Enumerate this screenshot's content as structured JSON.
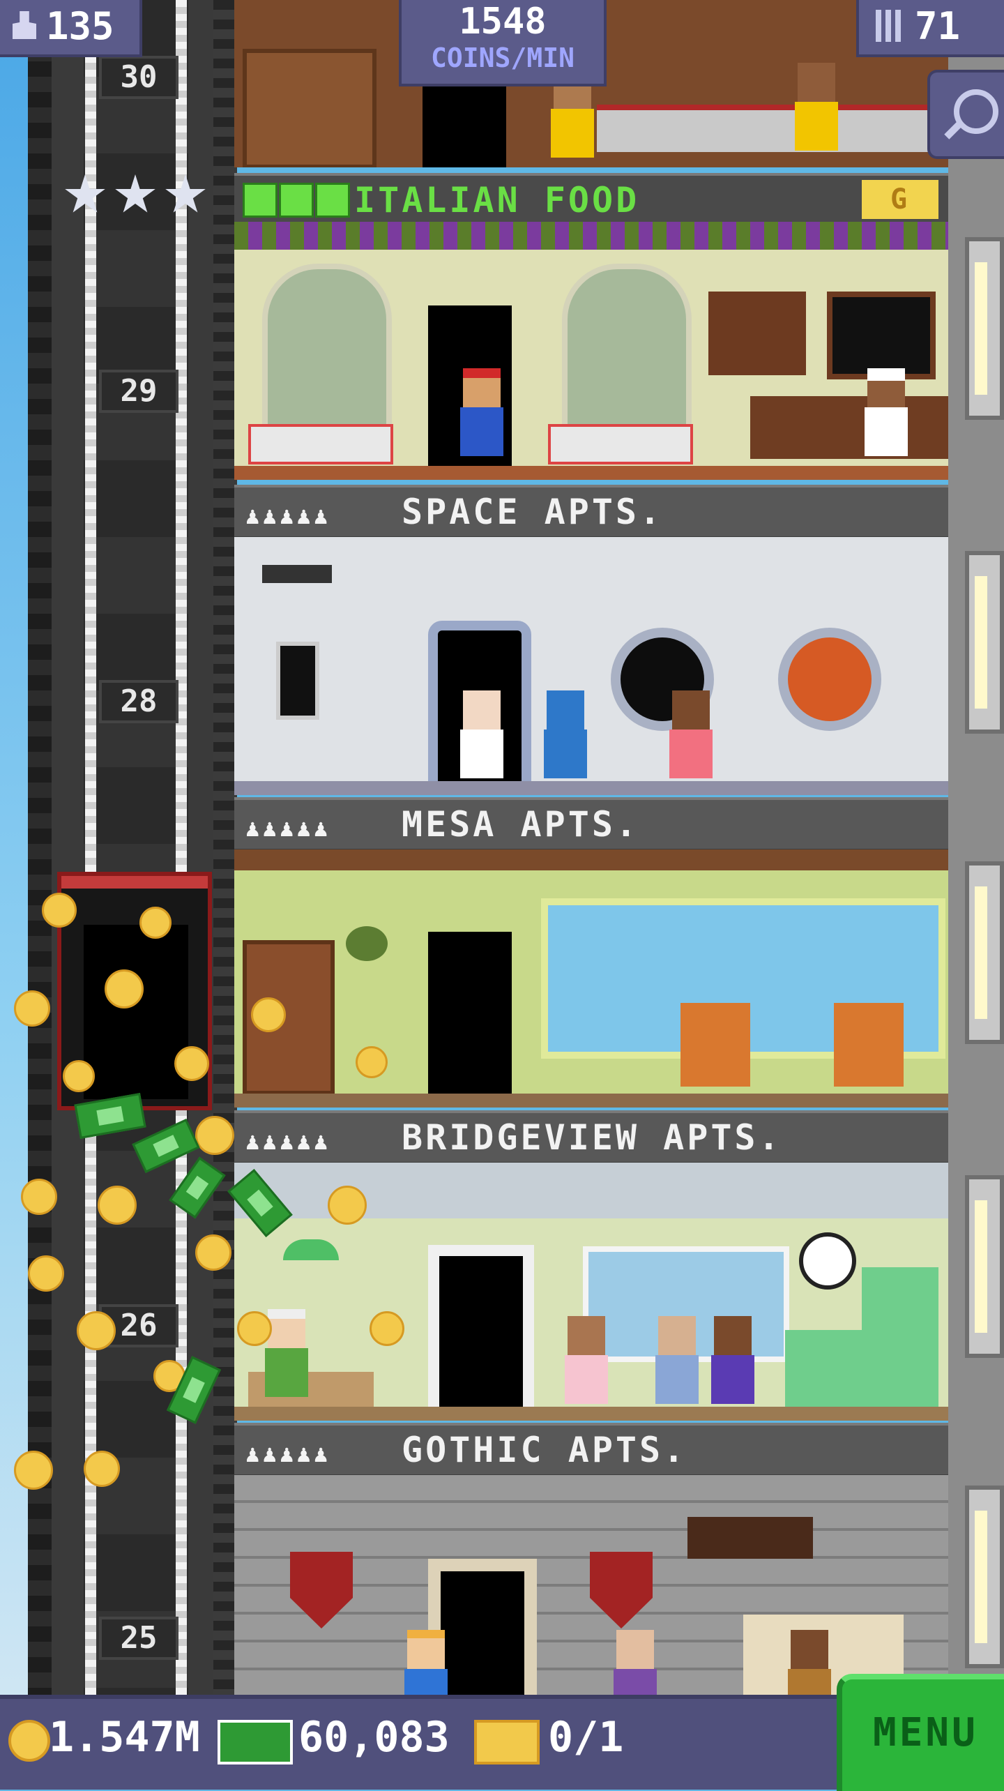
{
  "top_hud": {
    "population": "135",
    "coins_rate_value": "1548",
    "coins_rate_unit": "COINS/MIN",
    "floors": "71"
  },
  "floor_numbers": [
    "30",
    "29",
    "28",
    "26",
    "25"
  ],
  "floors": [
    {
      "name": "ITALIAN FOOD",
      "checks": 3,
      "badge": "G"
    },
    {
      "name": "SPACE APTS.",
      "occupancy": "♟♟♟♟♟"
    },
    {
      "name": "MESA APTS.",
      "occupancy": "♟♟♟♟♟"
    },
    {
      "name": "BRIDGEVIEW APTS.",
      "occupancy": "♟♟♟♟♟"
    },
    {
      "name": "GOTHIC APTS.",
      "occupancy": "♟♟♟♟♟"
    }
  ],
  "bottom_bar": {
    "coins": "1.547M",
    "bux": "60,083",
    "vip": "0/1",
    "menu_label": "MENU"
  },
  "icons": {
    "population": "person-icon",
    "floors": "building-icon",
    "zoom": "magnifier-icon",
    "stars": "star-icon",
    "coin": "coin-icon",
    "bux": "bux-icon",
    "vip": "ticket-icon"
  },
  "colors": {
    "hud_bg": "#5b5b8a",
    "menu_green": "#2bb53a",
    "label_bar": "#585858",
    "check_green": "#6adf45",
    "gold": "#f3c94b"
  }
}
